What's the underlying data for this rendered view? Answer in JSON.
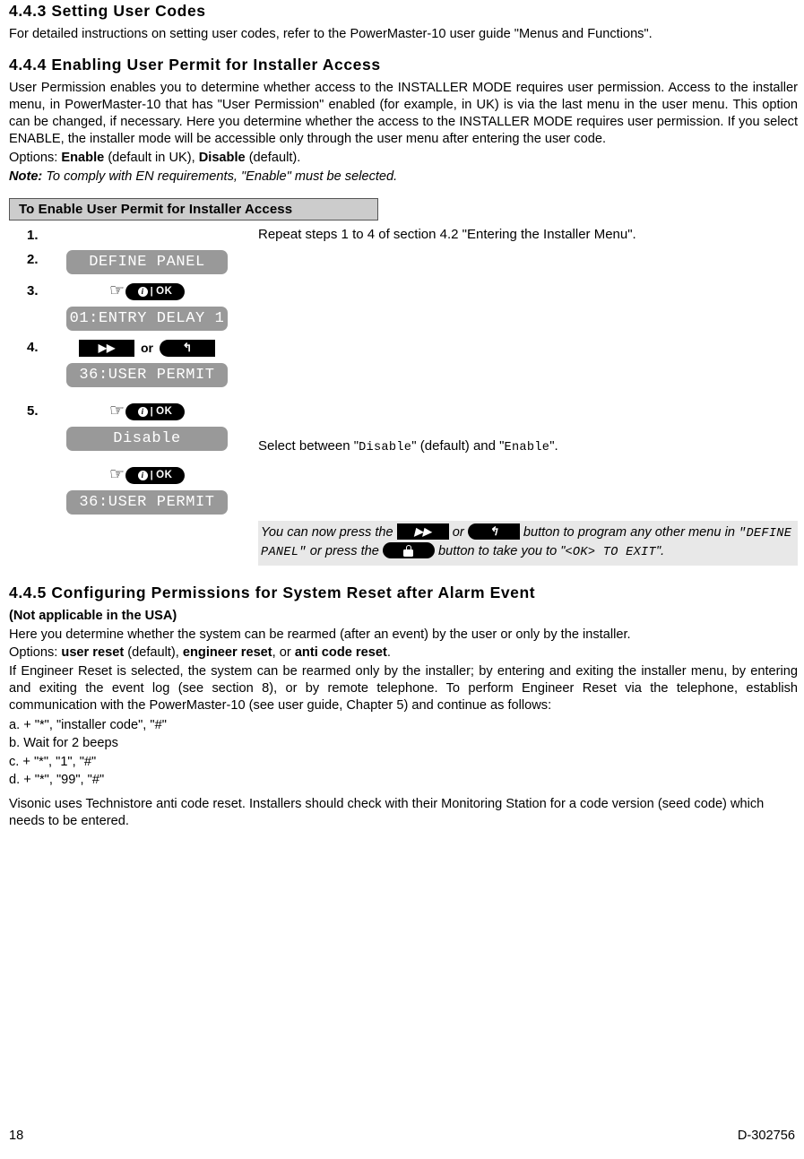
{
  "sections": {
    "s443": {
      "heading": "4.4.3 Setting User Codes",
      "para": "For detailed instructions on setting user codes, refer to the PowerMaster-10 user guide \"Menus and Functions\"."
    },
    "s444": {
      "heading": "4.4.4 Enabling User Permit for Installer Access",
      "para1": "User Permission enables you to determine whether access to the INSTALLER MODE requires user permission. Access to the installer menu, in PowerMaster-10 that has \"User Permission\" enabled (for example, in UK) is via the last menu in the user menu. This option can be changed, if necessary. Here you determine whether the access to the INSTALLER MODE requires user permission. If you select ENABLE, the installer mode will be accessible only through the user menu after entering the user code.",
      "options_prefix": "Options: ",
      "options_enable": "Enable",
      "options_mid": " (default in UK), ",
      "options_disable": "Disable",
      "options_suffix": " (default).",
      "note_label": "Note:",
      "note_text": " To comply with EN requirements, \"Enable\" must be selected."
    },
    "s445": {
      "heading": "4.4.5 Configuring Permissions for System Reset after Alarm Event",
      "subheading": "(Not applicable in the USA)",
      "para1": "Here you determine whether the system can be rearmed (after an event) by the user or only by the installer.",
      "options_prefix": "Options: ",
      "opt1": "user reset",
      "opt1_suffix": " (default), ",
      "opt2": "engineer reset",
      "opt2_suffix": ", or ",
      "opt3": "anti code reset",
      "opt3_suffix": ".",
      "para2": "If Engineer Reset is selected, the system can be rearmed only by the installer; by entering and exiting the installer menu, by entering and exiting the event log (see section 8), or by remote telephone. To perform Engineer Reset via the telephone, establish communication with the PowerMaster-10 (see user guide, Chapter 5) and continue as follows:",
      "steps": [
        "a. + \"*\", \"installer code\", \"#\"",
        "b. Wait for 2 beeps",
        "c. + \"*\", \"1\", \"#\"",
        "d. + \"*\", \"99\", \"#\""
      ],
      "para3": "Visonic uses Technistore anti code reset. Installers should check with their Monitoring Station for a code version (seed code) which needs to be entered."
    }
  },
  "procedure": {
    "title": "To Enable User Permit for Installer Access",
    "steps": [
      {
        "num": "1.",
        "text": "Repeat steps 1 to 4 of section 4.2 \"Entering the Installer Menu\"."
      },
      {
        "num": "2.",
        "lcd": "DEFINE PANEL"
      },
      {
        "num": "3.",
        "key": "ok",
        "lcd": "01:ENTRY DELAY 1"
      },
      {
        "num": "4.",
        "key": "next-or-back",
        "lcd": "36:USER PERMIT"
      },
      {
        "num": "5.",
        "key": "ok",
        "lcd": "Disable",
        "text_prefix": "Select between \"",
        "text_mono1": "Disable",
        "text_mid": "\" (default) and \"",
        "text_mono2": "Enable",
        "text_suffix": "\".",
        "key2": "ok",
        "lcd2": "36:USER PERMIT"
      }
    ],
    "keys": {
      "ok_label": "OK",
      "ok_bar": "|",
      "info_char": "i",
      "next_glyph": "▶▶",
      "back_glyph": "↰",
      "or_label": "or",
      "hand_glyph": "☞"
    },
    "note": {
      "p1": "You can now press the ",
      "p2": " or ",
      "p3": " button to program any other menu in ",
      "mono1": "\"DEFINE  PANEL\"",
      "p4": " or press the ",
      "p5": " button to take you to \"",
      "mono2": "<OK> TO EXIT",
      "p6": "\"."
    }
  },
  "footer": {
    "page_number": "18",
    "doc_code": "D-302756"
  },
  "colors": {
    "lcd_background": "#999999",
    "lcd_text": "#ffffff",
    "key_background": "#000000",
    "header_bar": "#cccccc",
    "note_background": "#e8e8e8"
  }
}
